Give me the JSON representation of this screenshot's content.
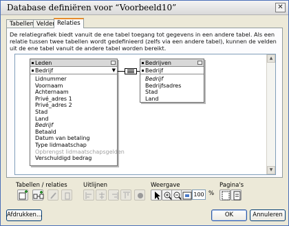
{
  "window": {
    "title": "Database definiëren voor “Voorbeeld10”",
    "close_glyph": "✕"
  },
  "tabs": [
    {
      "label": "Tabellen",
      "active": false
    },
    {
      "label": "Velden",
      "active": false
    },
    {
      "label": "Relaties",
      "active": true
    }
  ],
  "description": "De relatiegrafiek biedt vanuit de ene tabel toegang tot gegevens in een andere tabel. Als een relatie tussen twee tabellen wordt gedefinieerd (zelfs via een andere tabel), kunnen de velden uit de ene tabel vanuit de andere tabel worden bereikt.",
  "tables": {
    "leden": {
      "name": "Leden",
      "key_field": "Bedrijf",
      "fields": [
        {
          "label": "Lidnummer",
          "style": "normal"
        },
        {
          "label": "Voornaam",
          "style": "normal"
        },
        {
          "label": "Achternaam",
          "style": "normal"
        },
        {
          "label": "Privé_adres 1",
          "style": "normal"
        },
        {
          "label": "Privé_adres 2",
          "style": "normal"
        },
        {
          "label": "Stad",
          "style": "normal"
        },
        {
          "label": "Land",
          "style": "normal"
        },
        {
          "label": "Bedrijf",
          "style": "italic"
        },
        {
          "label": "Betaald",
          "style": "normal"
        },
        {
          "label": "Datum van betaling",
          "style": "normal"
        },
        {
          "label": "Type lidmaatschap",
          "style": "normal"
        },
        {
          "label": "Opbrengst lidmaatschapsgelden",
          "style": "grey"
        },
        {
          "label": "Verschuldigd bedrag",
          "style": "normal"
        }
      ]
    },
    "bedrijven": {
      "name": "Bedrijven",
      "key_field": "Bedrijf",
      "fields": [
        {
          "label": "Bedrijf",
          "style": "italic"
        },
        {
          "label": "Bedrijfsadres",
          "style": "normal"
        },
        {
          "label": "Stad",
          "style": "normal"
        },
        {
          "label": "Land",
          "style": "normal"
        }
      ]
    }
  },
  "relationship": {
    "operator": "="
  },
  "toolbar": {
    "group_tables_label": "Tabellen / relaties",
    "group_align_label": "Uitlijnen",
    "group_view_label": "Weergave",
    "group_pages_label": "Pagina's",
    "zoom_percent": "100",
    "percent_sign": "%",
    "icons": [
      "add-table-icon",
      "add-relationship-icon",
      "edit-icon",
      "delete-icon",
      "align-left-icon",
      "align-center-icon",
      "align-right-icon",
      "align-top-icon",
      "color-icon",
      "pointer-icon",
      "zoom-in-icon",
      "zoom-out-icon",
      "fit-window-icon",
      "page-breaks-icon",
      "page-setup-icon"
    ]
  },
  "buttons": {
    "print": "Afdrukken...",
    "ok": "OK",
    "cancel": "Annuleren"
  }
}
